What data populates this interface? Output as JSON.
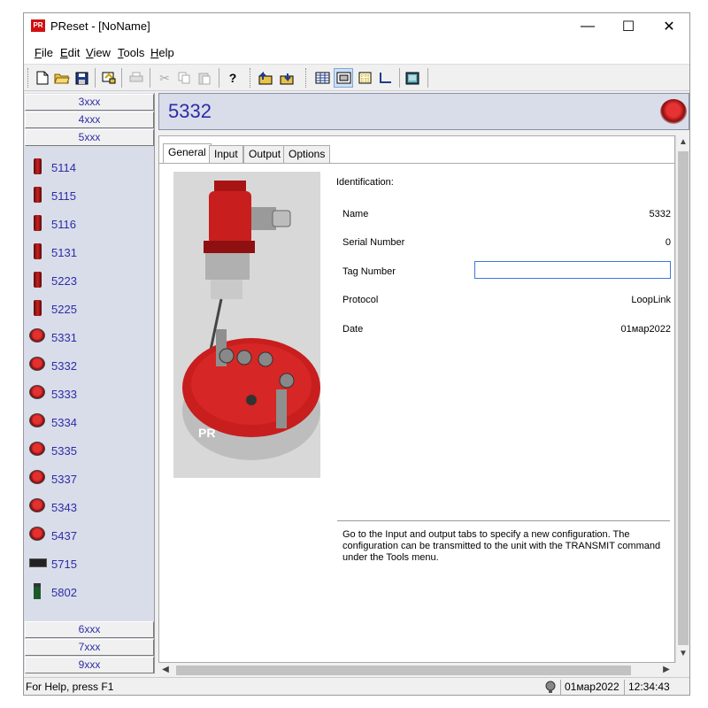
{
  "window": {
    "title": "PReset - [NoName]",
    "app_icon_text": "PR"
  },
  "menu": {
    "items": [
      {
        "key": "F",
        "rest": "ile"
      },
      {
        "key": "E",
        "rest": "dit"
      },
      {
        "key": "V",
        "rest": "iew"
      },
      {
        "key": "T",
        "rest": "ools"
      },
      {
        "key": "H",
        "rest": "elp"
      }
    ]
  },
  "toolbar": {
    "icons": [
      "new-file-icon",
      "open-folder-icon",
      "save-icon",
      "transmit-icon",
      "print-icon",
      "cut-icon",
      "copy-icon",
      "paste-icon",
      "help-icon",
      "upload-icon",
      "download-icon",
      "table-view-icon",
      "device-view-icon",
      "grid-view-icon",
      "chart-view-icon",
      "monitor-icon"
    ]
  },
  "sidebar": {
    "groups_top": [
      "3xxx",
      "4xxx",
      "5xxx"
    ],
    "items": [
      {
        "label": "5114",
        "icon": "cylinder-sensor-icon"
      },
      {
        "label": "5115",
        "icon": "cylinder-sensor-icon"
      },
      {
        "label": "5116",
        "icon": "cylinder-sensor-icon"
      },
      {
        "label": "5131",
        "icon": "cylinder-sensor-icon"
      },
      {
        "label": "5223",
        "icon": "cylinder-sensor-icon"
      },
      {
        "label": "5225",
        "icon": "cylinder-sensor-icon"
      },
      {
        "label": "5331",
        "icon": "head-transmitter-icon"
      },
      {
        "label": "5332",
        "icon": "head-transmitter-icon"
      },
      {
        "label": "5333",
        "icon": "head-transmitter-icon"
      },
      {
        "label": "5334",
        "icon": "head-transmitter-icon"
      },
      {
        "label": "5335",
        "icon": "head-transmitter-icon"
      },
      {
        "label": "5337",
        "icon": "head-transmitter-icon"
      },
      {
        "label": "5343",
        "icon": "head-transmitter-icon"
      },
      {
        "label": "5437",
        "icon": "head-transmitter-icon"
      },
      {
        "label": "5715",
        "icon": "display-unit-icon"
      },
      {
        "label": "5802",
        "icon": "rail-module-icon"
      }
    ],
    "groups_bottom": [
      "6xxx",
      "7xxx",
      "9xxx"
    ]
  },
  "header": {
    "title": "5332"
  },
  "tabs": [
    "General",
    "Input",
    "Output",
    "Options"
  ],
  "general": {
    "section_title": "Identification:",
    "fields": [
      {
        "label": "Name",
        "value": "5332"
      },
      {
        "label": "Serial Number",
        "value": "0"
      },
      {
        "label": "Tag Number",
        "value": ""
      },
      {
        "label": "Protocol",
        "value": "LoopLink"
      },
      {
        "label": "Date",
        "value": "01мар2022"
      }
    ],
    "info": "Go to the Input and output tabs to specify a new configuration. The configuration can be transmitted to the unit with the TRANSMIT command under the Tools menu."
  },
  "status": {
    "help": "For Help, press F1",
    "date": "01мар2022",
    "time": "12:34:43"
  }
}
